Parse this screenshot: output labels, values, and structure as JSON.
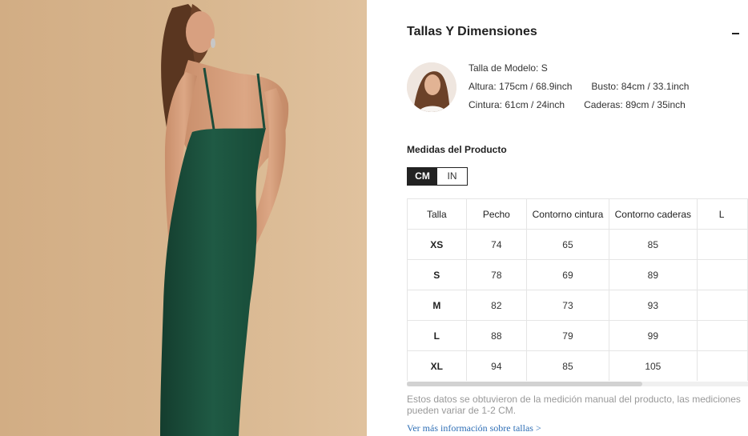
{
  "product_image": {
    "alt": "model wearing green cami maxi dress"
  },
  "size_panel": {
    "title": "Tallas Y Dimensiones",
    "collapse_icon": "minus-icon",
    "model": {
      "size_label": "Talla de Modelo: S",
      "height": "Altura: 175cm / 68.9inch",
      "bust": "Busto: 84cm / 33.1inch",
      "waist": "Cintura: 61cm / 24inch",
      "hips": "Caderas: 89cm / 35inch"
    },
    "measure_title": "Medidas del Producto",
    "units": {
      "cm": "CM",
      "in": "IN",
      "selected": "CM"
    },
    "table": {
      "headers": [
        "Talla",
        "Pecho",
        "Contorno cintura",
        "Contorno caderas",
        "L"
      ],
      "rows": [
        [
          "XS",
          "74",
          "65",
          "85",
          ""
        ],
        [
          "S",
          "78",
          "69",
          "89",
          ""
        ],
        [
          "M",
          "82",
          "73",
          "93",
          ""
        ],
        [
          "L",
          "88",
          "79",
          "99",
          ""
        ],
        [
          "XL",
          "94",
          "85",
          "105",
          ""
        ]
      ]
    },
    "note": "Estos datos se obtuvieron de la medición manual del producto, las mediciones pueden variar de 1-2 CM.",
    "more_link": "Ver más información sobre tallas >"
  },
  "colors": {
    "dress": "#1f5a44",
    "background": "#d6b48c",
    "link": "#2f6fb6"
  }
}
